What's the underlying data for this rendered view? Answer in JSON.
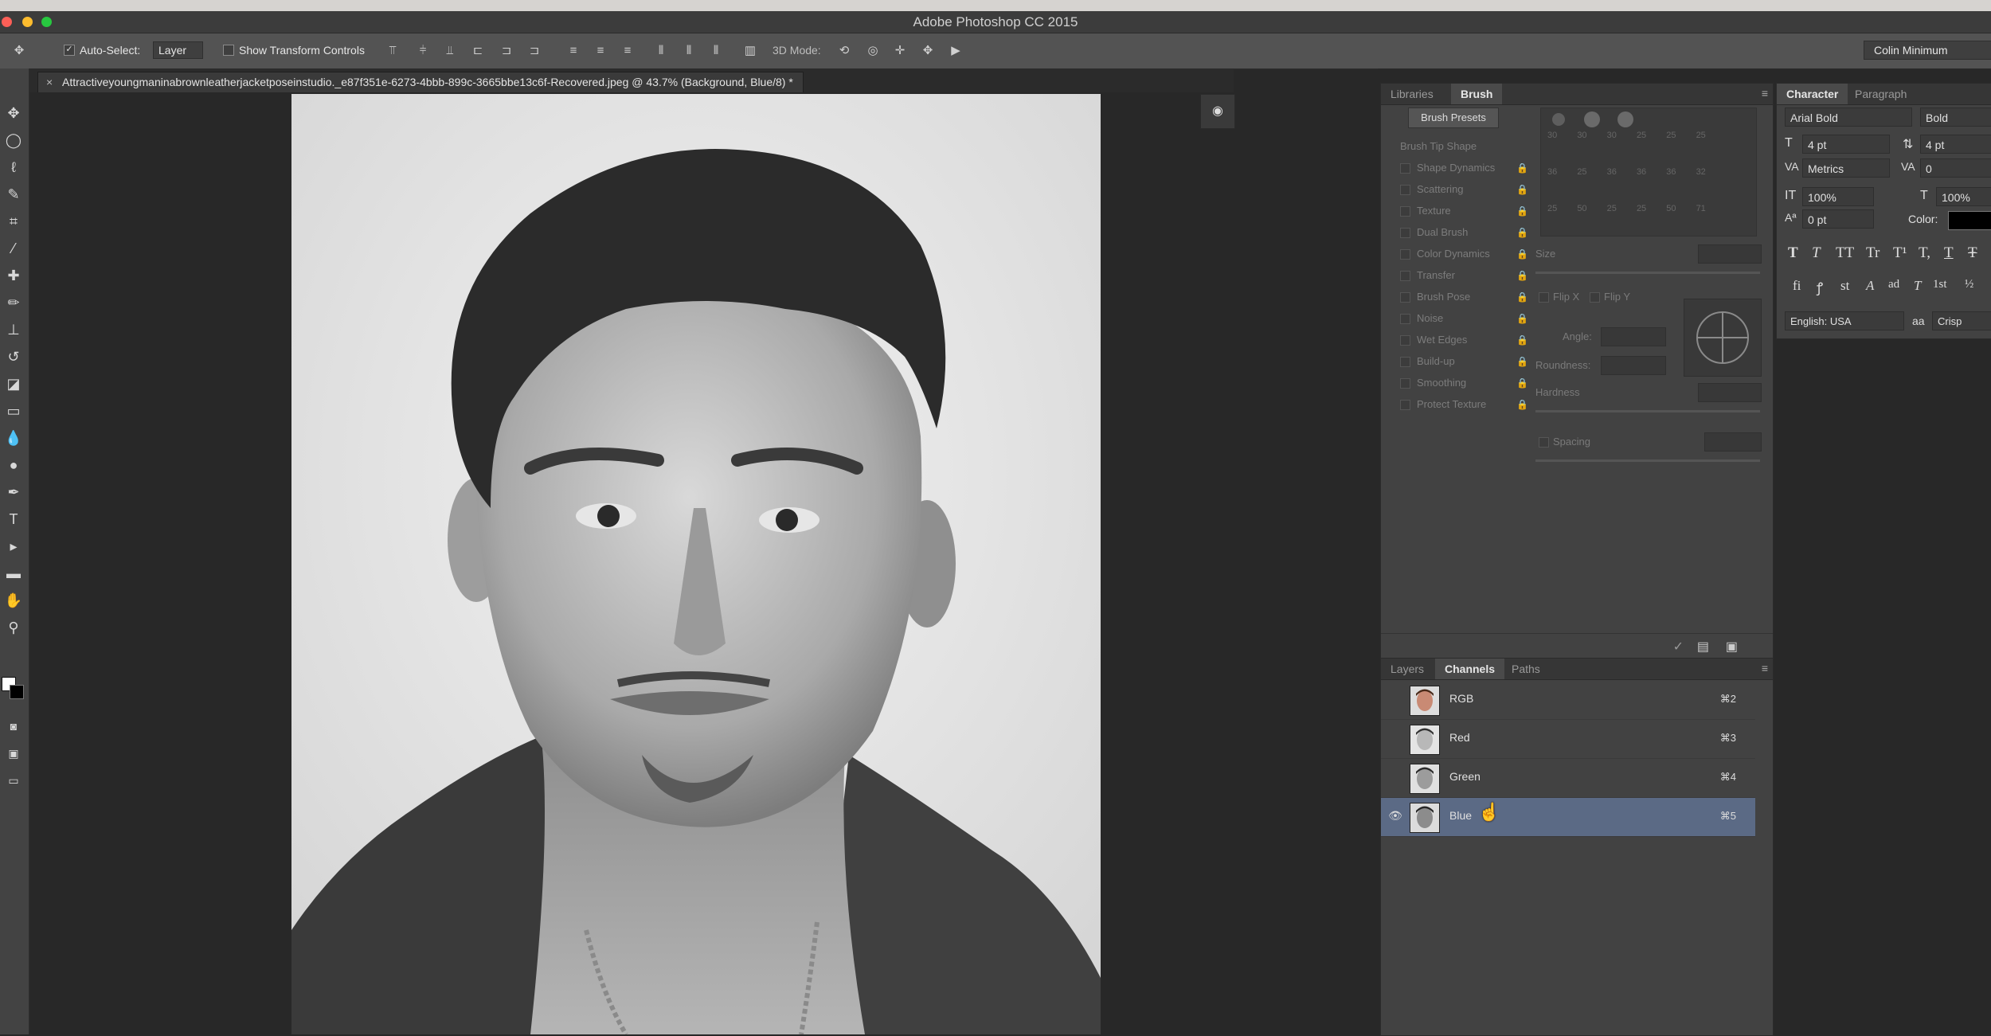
{
  "app": {
    "title": "Adobe Photoshop CC 2015",
    "menubar_right": "Colin Minimum"
  },
  "options": {
    "auto_select_label": "Auto-Select:",
    "auto_select_value": "Layer",
    "show_transform_label": "Show Transform Controls",
    "mode_3d_label": "3D Mode:"
  },
  "document": {
    "tab_label": "Attractiveyoungmaninabrownleatherjacketposeinstudio._e87f351e-6273-4bbb-899c-3665bbe13c6f-Recovered.jpeg @ 43.7% (Background, Blue/8) *"
  },
  "brush_panel": {
    "tabs": [
      "Libraries",
      "Brush"
    ],
    "active_tab": "Brush",
    "presets_button": "Brush Presets",
    "options": [
      "Brush Tip Shape",
      "Shape Dynamics",
      "Scattering",
      "Texture",
      "Dual Brush",
      "Color Dynamics",
      "Transfer",
      "Brush Pose",
      "Noise",
      "Wet Edges",
      "Build-up",
      "Smoothing",
      "Protect Texture"
    ],
    "tip_sizes_row1": [
      "30",
      "30",
      "30",
      "25",
      "25",
      "25"
    ],
    "tip_sizes_row2": [
      "36",
      "25",
      "36",
      "36",
      "36",
      "32"
    ],
    "tip_sizes_row3": [
      "25",
      "50",
      "25",
      "25",
      "50",
      "71"
    ],
    "size_label": "Size",
    "flip_x": "Flip X",
    "flip_y": "Flip Y",
    "angle_label": "Angle:",
    "roundness_label": "Roundness:",
    "hardness_label": "Hardness",
    "spacing_label": "Spacing"
  },
  "channels_panel": {
    "tabs": [
      "Layers",
      "Channels",
      "Paths"
    ],
    "active_tab": "Channels",
    "channels": [
      {
        "name": "RGB",
        "shortcut": "⌘2",
        "selected": false
      },
      {
        "name": "Red",
        "shortcut": "⌘3",
        "selected": false
      },
      {
        "name": "Green",
        "shortcut": "⌘4",
        "selected": false
      },
      {
        "name": "Blue",
        "shortcut": "⌘5",
        "selected": true
      }
    ]
  },
  "character_panel": {
    "tabs": [
      "Character",
      "Paragraph"
    ],
    "active_tab": "Character",
    "font_family": "Arial Bold",
    "font_style": "Bold",
    "font_size": "4 pt",
    "leading": "4 pt",
    "kerning": "Metrics",
    "tracking": "0",
    "vertical_scale": "100%",
    "horizontal_scale": "100%",
    "baseline_shift": "0 pt",
    "color_label": "Color:",
    "language": "English: USA",
    "aa_label": "aa",
    "antialias": "Crisp",
    "type_buttons": [
      "T",
      "T",
      "TT",
      "Tr",
      "T¹",
      "T,",
      "T",
      "Ŧ"
    ],
    "opentype_buttons": [
      "fi",
      "ꝭ",
      "st",
      "A",
      "ad",
      "T",
      "1st",
      "½"
    ]
  },
  "colors": {
    "accent_selection": "#5b6a85",
    "panel_bg": "#424242",
    "canvas_bg": "#282828"
  }
}
